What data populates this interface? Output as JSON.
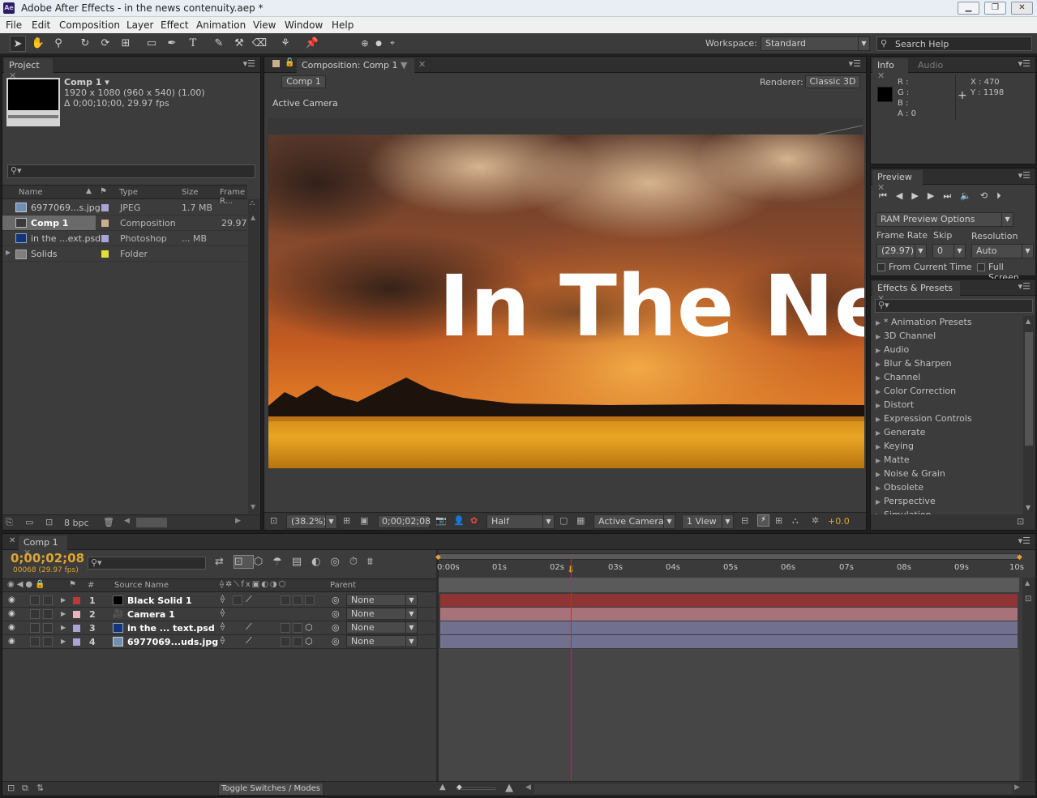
{
  "window": {
    "title": "Adobe After Effects - in the news contenuity.aep *",
    "app_badge": "Ae"
  },
  "menu": [
    "File",
    "Edit",
    "Composition",
    "Layer",
    "Effect",
    "Animation",
    "View",
    "Window",
    "Help"
  ],
  "toolbar": {
    "workspace_label": "Workspace:",
    "workspace_value": "Standard",
    "search_placeholder": "Search Help"
  },
  "project": {
    "tab": "Project",
    "comp_name": "Comp 1 ▾",
    "comp_res": "1920 x 1080  (960 x 540) (1.00)",
    "comp_dur": "Δ 0;00;10;00, 29.97 fps",
    "columns": [
      "Name",
      "Type",
      "Size",
      "Frame R..."
    ],
    "items": [
      {
        "name": "6977069...s.jpg",
        "type": "JPEG",
        "size": "1.7 MB",
        "rate": "",
        "color": "#a9a4d6"
      },
      {
        "name": "Comp 1",
        "type": "Composition",
        "size": "",
        "rate": "29.97",
        "color": "#c8b08b"
      },
      {
        "name": "in the ...ext.psd",
        "type": "Photoshop",
        "size": "... MB",
        "rate": "",
        "color": "#a9a4d6"
      },
      {
        "name": "Solids",
        "type": "Folder",
        "size": "",
        "rate": "",
        "color": "#e3de3b"
      }
    ],
    "bpc": "8 bpc"
  },
  "composition": {
    "tab": "Composition: Comp 1",
    "subtab": "Comp 1",
    "renderer_label": "Renderer:",
    "renderer_value": "Classic 3D",
    "view_label": "Active Camera",
    "headline": "In The Ne",
    "zoom": "(38.2%)",
    "timecode": "0;00;02;08",
    "resolution": "Half",
    "camera": "Active Camera",
    "views": "1 View",
    "exposure": "+0.0"
  },
  "info": {
    "tab": "Info",
    "tab2": "Audio",
    "r": "R :",
    "g": "G :",
    "b": "B :",
    "a": "A : 0",
    "x": "X : 470",
    "y": "Y : 1198"
  },
  "preview": {
    "tab": "Preview",
    "ram_options": "RAM Preview Options",
    "frame_rate_label": "Frame Rate",
    "skip_label": "Skip",
    "resolution_label": "Resolution",
    "frame_rate": "(29.97)",
    "skip": "0",
    "resolution": "Auto",
    "from_current": "From Current Time",
    "full_screen": "Full Screen"
  },
  "effects": {
    "tab": "Effects & Presets",
    "items": [
      "* Animation Presets",
      "3D Channel",
      "Audio",
      "Blur & Sharpen",
      "Channel",
      "Color Correction",
      "Distort",
      "Expression Controls",
      "Generate",
      "Keying",
      "Matte",
      "Noise & Grain",
      "Obsolete",
      "Perspective",
      "Simulation"
    ]
  },
  "timeline": {
    "tab": "Comp 1",
    "timecode": "0;00;02;08",
    "frame_info": "00068 (29.97 fps)",
    "col_source": "Source Name",
    "col_parent": "Parent",
    "col_num": "#",
    "ruler": [
      "0:00s",
      "01s",
      "02s",
      "03s",
      "04s",
      "05s",
      "06s",
      "07s",
      "08s",
      "09s",
      "10s"
    ],
    "layers": [
      {
        "num": "1",
        "name": "Black Solid 1",
        "parent": "None",
        "color": "#b83a3a",
        "bar": "#8e3434"
      },
      {
        "num": "2",
        "name": "Camera 1",
        "parent": "None",
        "color": "#e8b3be",
        "bar": "#a8727b"
      },
      {
        "num": "3",
        "name": "in the ... text.psd",
        "parent": "None",
        "color": "#a9a4d6",
        "bar": "#72708f"
      },
      {
        "num": "4",
        "name": "6977069...uds.jpg",
        "parent": "None",
        "color": "#a9a4d6",
        "bar": "#72708f"
      }
    ],
    "toggle": "Toggle Switches / Modes"
  }
}
